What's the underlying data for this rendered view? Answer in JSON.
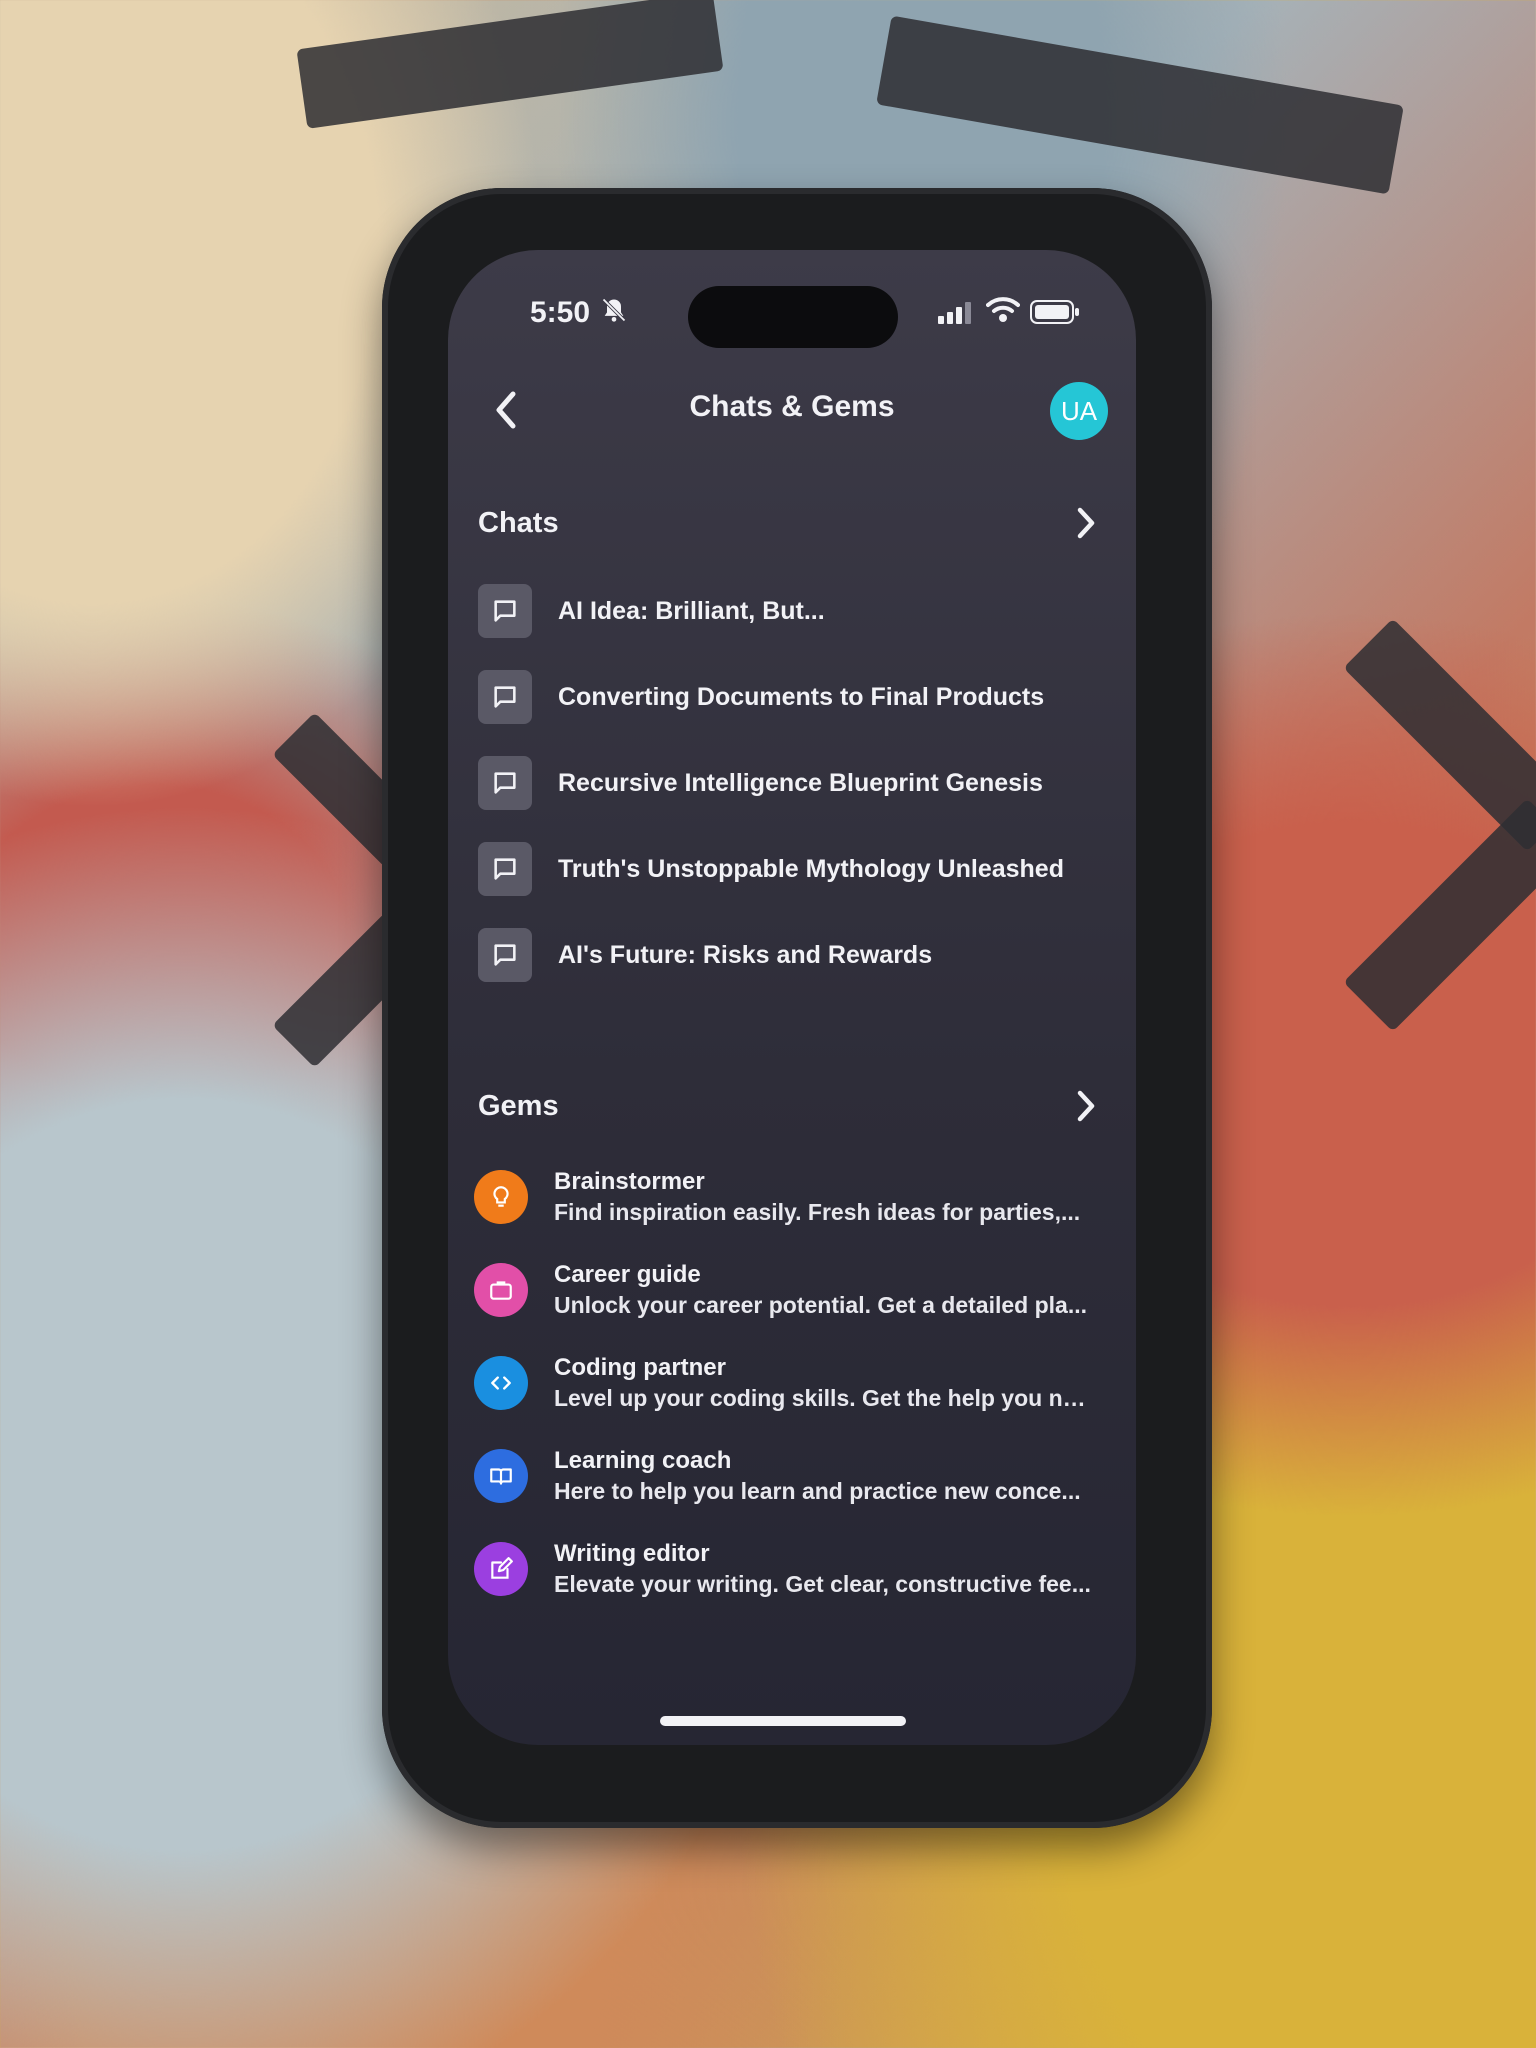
{
  "status_bar": {
    "time": "5:50"
  },
  "header": {
    "title": "Chats & Gems",
    "avatar_initials": "UA"
  },
  "chats": {
    "title": "Chats",
    "items": [
      {
        "label": "AI Idea: Brilliant, But..."
      },
      {
        "label": "Converting Documents to Final Products"
      },
      {
        "label": "Recursive Intelligence Blueprint Genesis"
      },
      {
        "label": "Truth's Unstoppable Mythology Unleashed"
      },
      {
        "label": "AI's Future: Risks and Rewards"
      }
    ]
  },
  "gems": {
    "title": "Gems",
    "items": [
      {
        "name": "Brainstormer",
        "desc": "Find inspiration easily. Fresh ideas for parties,...",
        "icon": "lightbulb-icon",
        "color": "#f07b1a"
      },
      {
        "name": "Career guide",
        "desc": "Unlock your career potential. Get a detailed pla...",
        "icon": "briefcase-icon",
        "color": "#e24fa8"
      },
      {
        "name": "Coding partner",
        "desc": "Level up your coding skills. Get the help you ne...",
        "icon": "code-icon",
        "color": "#1a8fe0"
      },
      {
        "name": "Learning coach",
        "desc": "Here to help you learn and practice new conce...",
        "icon": "book-icon",
        "color": "#2d6de0"
      },
      {
        "name": "Writing editor",
        "desc": "Elevate your writing. Get clear, constructive fee...",
        "icon": "edit-icon",
        "color": "#9b3fe0"
      }
    ]
  }
}
